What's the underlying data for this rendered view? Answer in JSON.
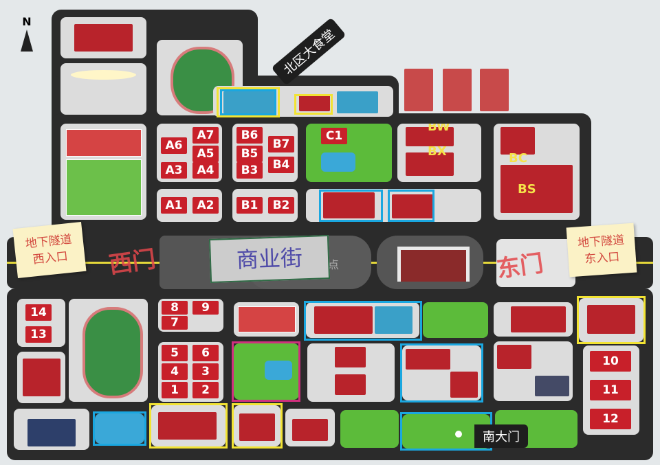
{
  "compass": {
    "label": "N"
  },
  "tags": {
    "north_canteen": "北区大食堂",
    "south_gate": "南大门"
  },
  "notes": {
    "west": "地下隧道\n西入口",
    "east": "地下隧道\n东入口"
  },
  "gates": {
    "west": "西门",
    "east": "东门"
  },
  "street": {
    "label": "商业街",
    "overlay": "会地点"
  },
  "dorms_north": {
    "a": [
      "A6",
      "A7",
      "A5",
      "A3",
      "A4"
    ],
    "a_lower": [
      "A1",
      "A2"
    ],
    "b": [
      "B6",
      "B7",
      "B5",
      "B3",
      "B4"
    ],
    "b_lower": [
      "B1",
      "B2"
    ],
    "c": "C1",
    "bw": "BW",
    "bx": "BX",
    "bc": "BC",
    "bs": "BS"
  },
  "dorms_south": {
    "west": [
      "14",
      "13"
    ],
    "mid_top": [
      "8",
      "9",
      "7"
    ],
    "mid": [
      "5",
      "6",
      "4",
      "3",
      "1",
      "2"
    ],
    "east": [
      "10",
      "11",
      "12"
    ]
  },
  "colors": {
    "road": "#2b2b2b",
    "dorm": "#c8202a",
    "highlight_cyan": "#1aa7e0",
    "highlight_yellow": "#f2e333",
    "highlight_magenta": "#d0307e"
  }
}
